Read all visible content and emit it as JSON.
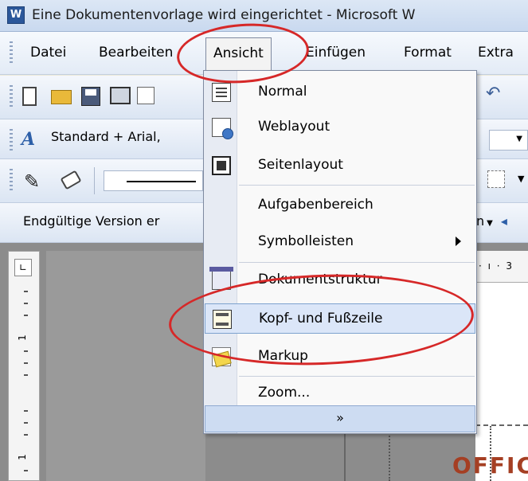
{
  "window": {
    "title": "Eine Dokumentenvorlage wird eingerichtet - Microsoft W",
    "app_icon": "W"
  },
  "menubar": {
    "items": [
      {
        "label": "Datei"
      },
      {
        "label": "Bearbeiten"
      },
      {
        "label": "Ansicht",
        "active": true
      },
      {
        "label": "Einfügen"
      },
      {
        "label": "Format"
      },
      {
        "label": "Extra"
      }
    ]
  },
  "formatting": {
    "style_value": "Standard + Arial,"
  },
  "review": {
    "display_value": "Endgültige Version er",
    "right_label": "n"
  },
  "ruler": {
    "vertical_numbers": [
      "1",
      "1"
    ],
    "horizontal_text": "· ı · 3"
  },
  "document": {
    "visible_text": "OFFIC"
  },
  "view_menu": {
    "items": [
      {
        "label": "Normal",
        "icon": "normal-view-icon"
      },
      {
        "label": "Weblayout",
        "icon": "web-layout-icon"
      },
      {
        "label": "Seitenlayout",
        "icon": "page-layout-icon"
      },
      {
        "label": "Aufgabenbereich",
        "icon": ""
      },
      {
        "label": "Symbolleisten",
        "icon": "",
        "submenu": true
      },
      {
        "label": "Dokumentstruktur",
        "icon": "document-map-icon"
      },
      {
        "label": "Kopf- und Fußzeile",
        "icon": "header-footer-icon",
        "highlighted": true
      },
      {
        "label": "Markup",
        "icon": "markup-icon"
      },
      {
        "label": "Zoom...",
        "icon": ""
      }
    ],
    "expand_glyph": "¥"
  },
  "colors": {
    "annotation": "#d62828",
    "highlight": "#dbe6f8",
    "accent": "#2b579a"
  }
}
